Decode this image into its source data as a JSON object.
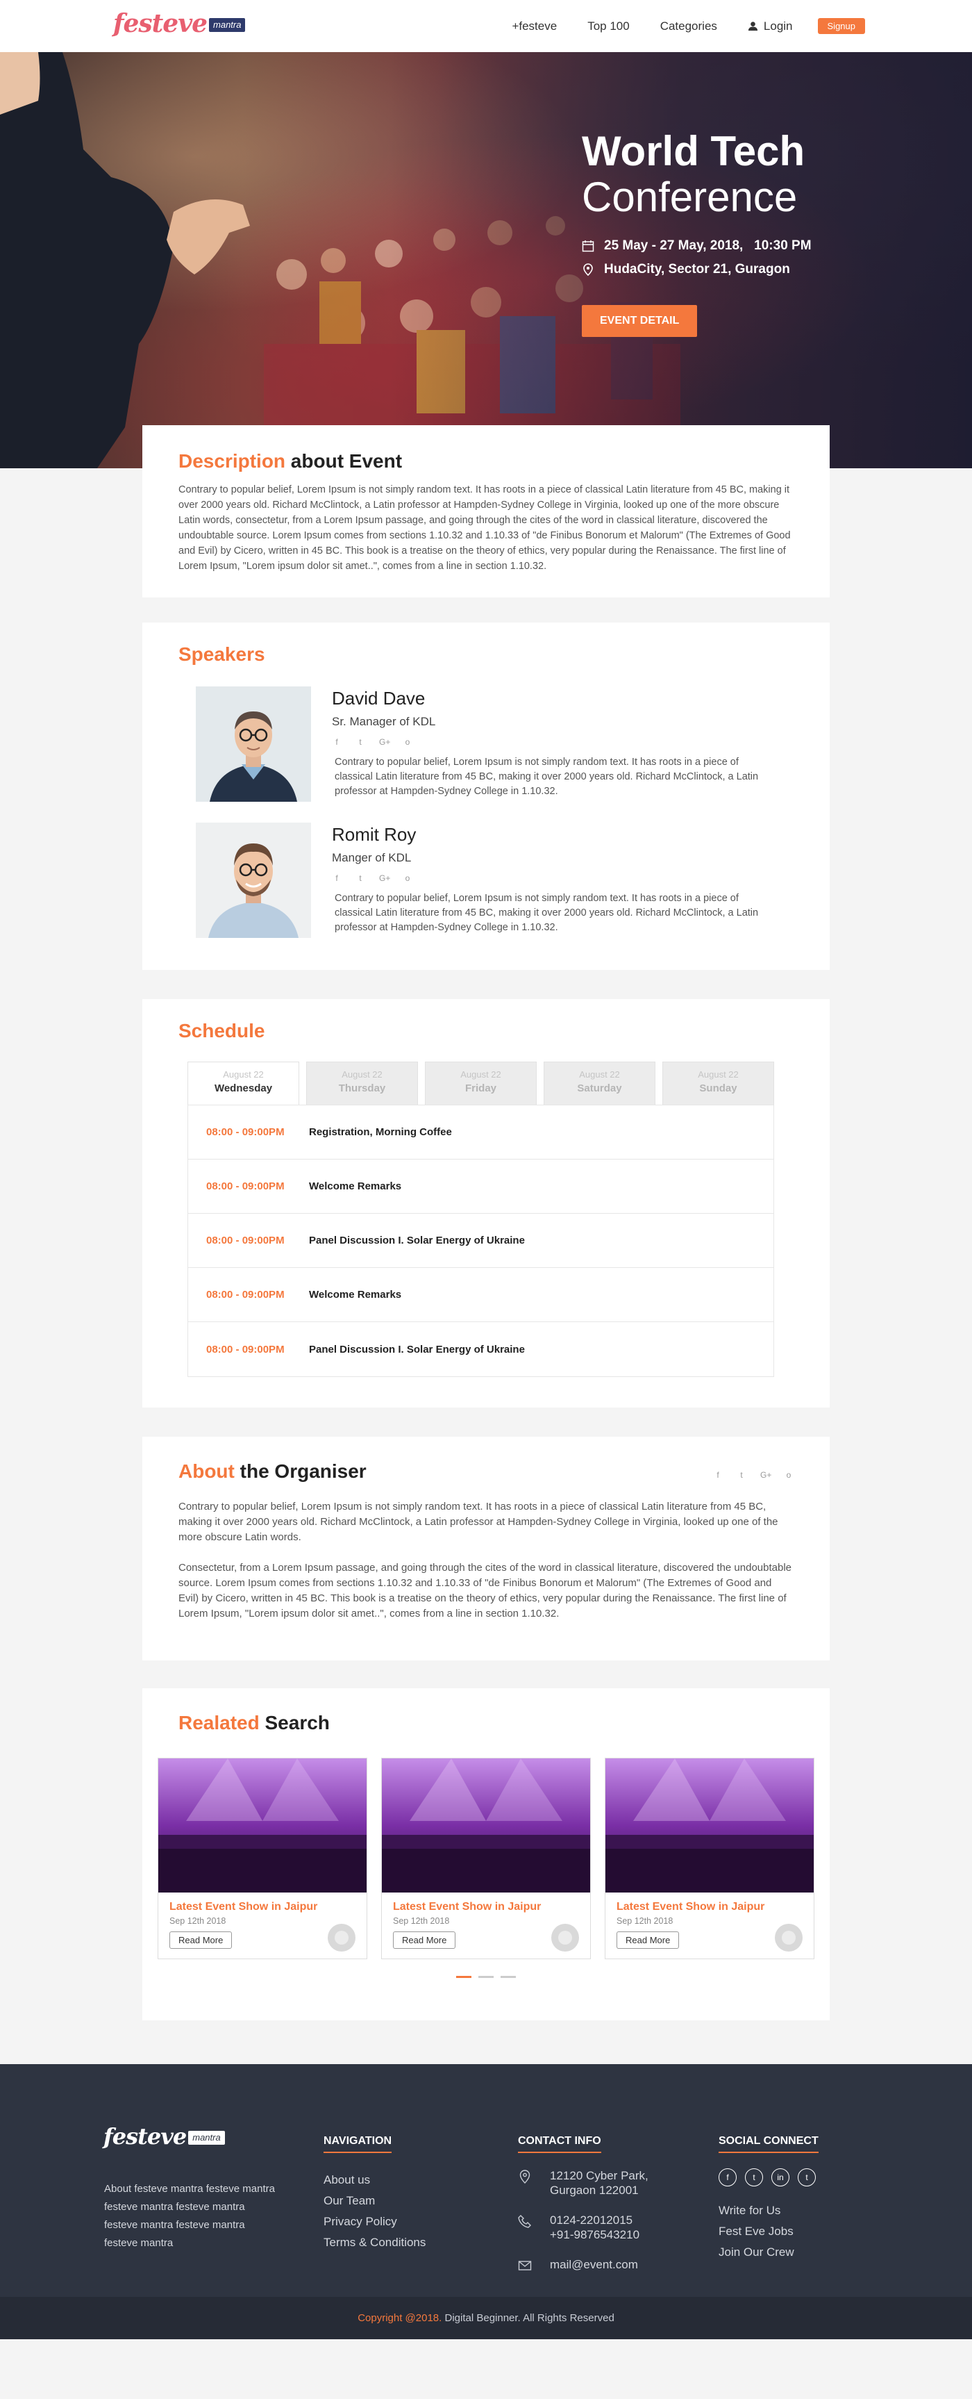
{
  "header": {
    "logo_text": "festeve",
    "logo_tag": "mantra",
    "nav": [
      "+festeve",
      "Top 100",
      "Categories"
    ],
    "login": "Login",
    "signup": "Signup"
  },
  "hero": {
    "title_line1": "World Tech",
    "title_line2": "Conference",
    "date": "25 May - 27 May, 2018,   10:30 PM",
    "location": "HudaCity, Sector 21, Guragon",
    "button": "EVENT DETAIL",
    "icons": [
      "calendar-icon",
      "location-pin-icon"
    ]
  },
  "description": {
    "title_accent": "Description",
    "title_rest": " about Event",
    "text": "Contrary to popular belief, Lorem Ipsum is not simply random text. It has roots in a piece of classical Latin literature from 45 BC, making it over 2000 years old. Richard McClintock, a Latin professor at Hampden-Sydney College in Virginia, looked up one of the more obscure Latin words, consectetur, from a Lorem Ipsum passage, and going through the cites of the word in classical literature, discovered the undoubtable source. Lorem Ipsum comes from sections 1.10.32 and 1.10.33 of \"de Finibus Bonorum et Malorum\" (The Extremes of Good and Evil) by Cicero, written in 45 BC. This book is a treatise on the theory of ethics, very popular during the Renaissance. The first line of Lorem Ipsum, \"Lorem ipsum dolor sit amet..\", comes from a line in section 1.10.32."
  },
  "speakers": {
    "title": "Speakers",
    "social": [
      "f",
      "t",
      "G+",
      "o"
    ],
    "items": [
      {
        "name": "David Dave",
        "role": "Sr. Manager of KDL",
        "bio": "Contrary to popular belief, Lorem Ipsum is not simply random text. It has roots in a piece of classical Latin literature from 45 BC, making it over 2000 years old. Richard McClintock, a Latin professor at Hampden-Sydney College in  1.10.32."
      },
      {
        "name": "Romit Roy",
        "role": "Manger of KDL",
        "bio": "Contrary to popular belief, Lorem Ipsum is not simply random text. It has roots in a piece of classical Latin literature from 45 BC, making it over 2000 years old. Richard McClintock, a Latin professor at Hampden-Sydney College in  1.10.32."
      }
    ]
  },
  "schedule": {
    "title": "Schedule",
    "tabs": [
      {
        "date": "August 22",
        "day": "Wednesday"
      },
      {
        "date": "August 22",
        "day": "Thursday"
      },
      {
        "date": "August 22",
        "day": "Friday"
      },
      {
        "date": "August 22",
        "day": "Saturday"
      },
      {
        "date": "August 22",
        "day": "Sunday"
      }
    ],
    "rows": [
      {
        "time": "08:00 - 09:00PM",
        "title": "Registration, Morning Coffee"
      },
      {
        "time": "08:00 - 09:00PM",
        "title": "Welcome Remarks"
      },
      {
        "time": "08:00 - 09:00PM",
        "title": "Panel Discussion I. Solar Energy of Ukraine"
      },
      {
        "time": "08:00 - 09:00PM",
        "title": "Welcome Remarks"
      },
      {
        "time": "08:00 - 09:00PM",
        "title": "Panel Discussion I. Solar Energy of Ukraine"
      }
    ]
  },
  "organiser": {
    "title_accent": "About",
    "title_rest": " the Organiser",
    "para1": "Contrary to popular belief, Lorem Ipsum is not simply random text. It has roots in a piece of classical Latin literature from 45 BC, making it over 2000 years old. Richard McClintock, a Latin professor at Hampden-Sydney College in Virginia, looked up one of the more obscure Latin words.",
    "para2": "Consectetur, from a Lorem Ipsum passage, and going through the cites of the word in classical literature, discovered the undoubtable source. Lorem Ipsum comes from sections 1.10.32 and 1.10.33 of \"de Finibus Bonorum et Malorum\" (The Extremes of Good and Evil) by Cicero, written in 45 BC. This book is a treatise on the theory of ethics, very popular during the Renaissance. The first line of Lorem Ipsum, \"Lorem ipsum dolor sit amet..\", comes from a line in section 1.10.32."
  },
  "related": {
    "title_accent": "Realated",
    "title_rest": " Search",
    "events": [
      {
        "title": "Latest Event Show in Jaipur",
        "date": "Sep 12th 2018",
        "button": "Read More"
      },
      {
        "title": "Latest Event Show in Jaipur",
        "date": "Sep 12th 2018",
        "button": "Read More"
      },
      {
        "title": "Latest Event Show in Jaipur",
        "date": "Sep 12th 2018",
        "button": "Read More"
      }
    ]
  },
  "footer": {
    "logo_text": "festeve",
    "logo_tag": "mantra",
    "about": "About festeve mantra festeve mantra  festeve mantra festeve mantra festeve mantra festeve mantra festeve mantra",
    "navigation": {
      "heading": "NAVIGATION",
      "links": [
        "About us",
        "Our Team",
        "Privacy Policy",
        "Terms & Conditions"
      ]
    },
    "contact": {
      "heading": "CONTACT INFO",
      "address_line1": "12120 Cyber Park,",
      "address_line2": "Gurgaon 122001",
      "phone1": "0124-22012015",
      "phone2": "+91-9876543210",
      "email": "mail@event.com"
    },
    "social": {
      "heading": "SOCIAL CONNECT",
      "icons": [
        "f",
        "t",
        "in",
        "t"
      ],
      "links": [
        "Write for Us",
        "Fest Eve Jobs",
        "Join Our Crew"
      ]
    },
    "copyright_accent": "Copyright @2018.",
    "copyright_rest": " Digital Beginner. All Rights Reserved"
  },
  "colors": {
    "accent": "#f4783d",
    "footer_bg": "#2e3441",
    "brand": "#e85f70"
  }
}
